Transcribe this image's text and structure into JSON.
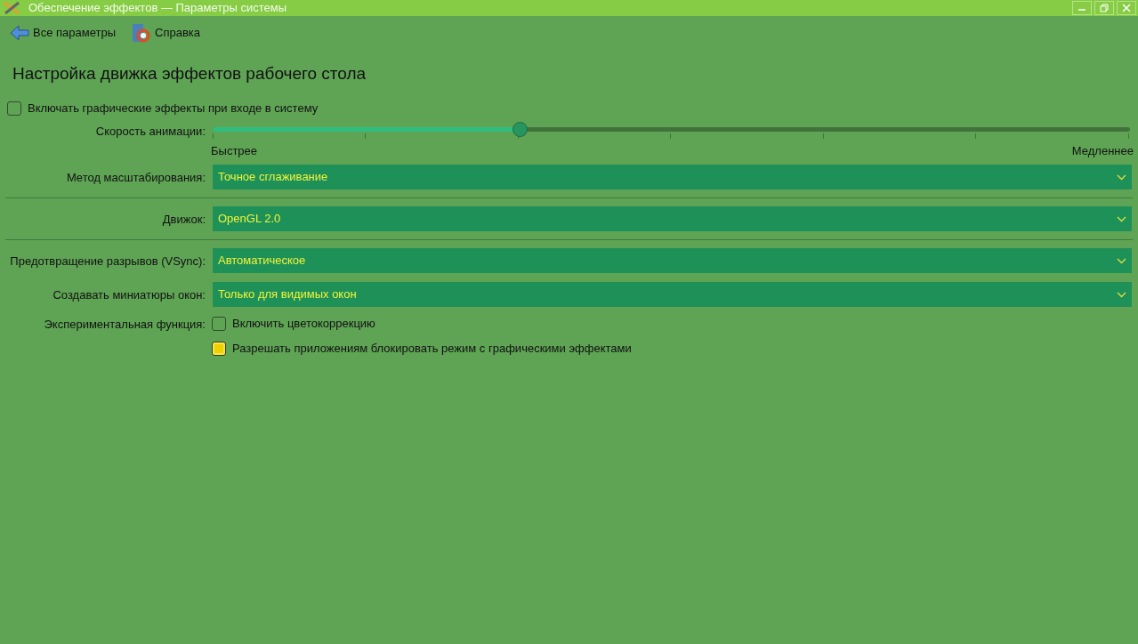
{
  "window": {
    "title": "Обеспечение эффектов — Параметры системы"
  },
  "toolbar": [
    {
      "kind": "back",
      "label": "Все параметры"
    },
    {
      "kind": "help",
      "label": "Справка"
    }
  ],
  "heading": "Настройка движка эффектов рабочего стола",
  "login_effects": {
    "label": "Включать графические эффекты при входе в систему",
    "checked": false
  },
  "animation_speed": {
    "label": "Скорость анимации:",
    "level": 0.335,
    "min_label": "Быстрее",
    "max_label": "Медленнее"
  },
  "rows": [
    {
      "kind": "combo",
      "label": "Метод масштабирования:",
      "value": "Точное сглаживание",
      "separator_after": true
    },
    {
      "kind": "combo",
      "label": "Движок:",
      "value": "OpenGL 2.0",
      "separator_after": true
    },
    {
      "kind": "combo",
      "label": "Предотвращение разрывов (VSync):",
      "value": "Автоматическое",
      "separator_after": false
    },
    {
      "kind": "combo",
      "label": "Создавать миниатюры окон:",
      "value": "Только для видимых окон",
      "separator_after": false
    },
    {
      "kind": "check",
      "label": "Экспериментальная функция:",
      "text": "Включить цветокоррекцию",
      "checked": false
    },
    {
      "kind": "check",
      "text": "Разрешать приложениям блокировать режим с графическими эффектами",
      "checked": true
    }
  ]
}
